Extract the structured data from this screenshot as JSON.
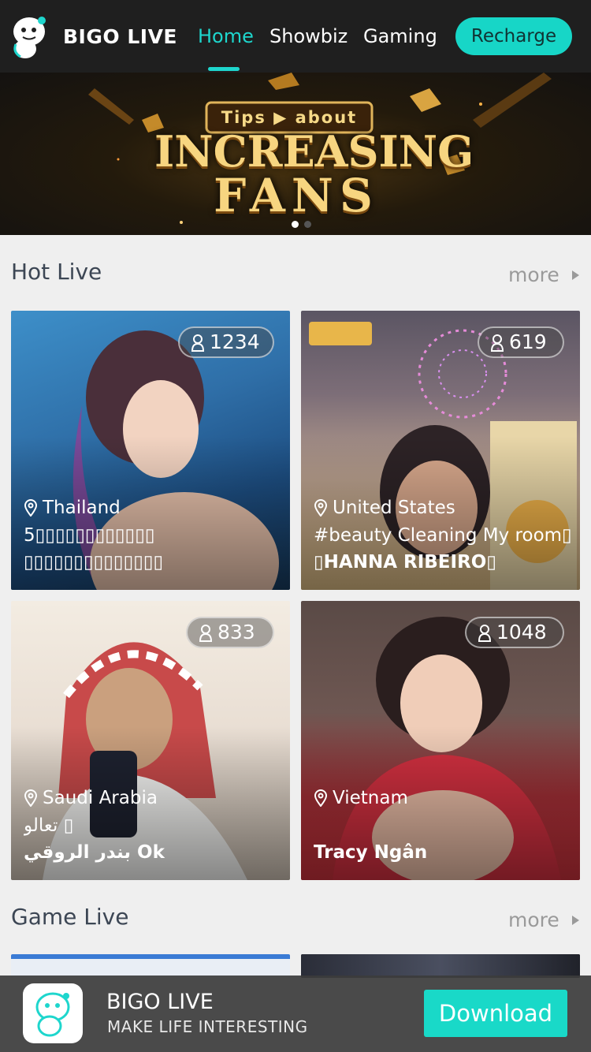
{
  "brand": {
    "name": "BIGO LIVE",
    "accent": "#1ed6cd"
  },
  "nav": {
    "items": [
      {
        "label": "Home",
        "active": true
      },
      {
        "label": "Showbiz",
        "active": false
      },
      {
        "label": "Gaming",
        "active": false
      }
    ],
    "recharge_label": "Recharge"
  },
  "banner": {
    "tips": "Tips ▶ about",
    "line1": "INCREASING",
    "line2": "FANS",
    "slide_count": 2,
    "active_slide": 1
  },
  "hot_live": {
    "title": "Hot Live",
    "more_label": "more",
    "cards": [
      {
        "viewers": "1234",
        "location": "Thailand",
        "description": "5▯▯▯▯▯▯▯▯▯▯▯▯",
        "name": "▯▯▯▯▯▯▯▯▯▯▯▯▯▯"
      },
      {
        "viewers": "619",
        "location": "United States",
        "description": "#beauty Cleaning My room▯",
        "name": "▯HANNA RIBEIRO▯"
      },
      {
        "viewers": "833",
        "location": "Saudi Arabia",
        "description": "تعالو ▯",
        "name": "بندر الروقي Ok"
      },
      {
        "viewers": "1048",
        "location": "Vietnam",
        "description": "",
        "name": "Tracy Ngân"
      }
    ]
  },
  "game_live": {
    "title": "Game Live",
    "more_label": "more"
  },
  "download_bar": {
    "title": "BIGO LIVE",
    "subtitle": "MAKE LIFE INTERESTING",
    "button_label": "Download"
  }
}
